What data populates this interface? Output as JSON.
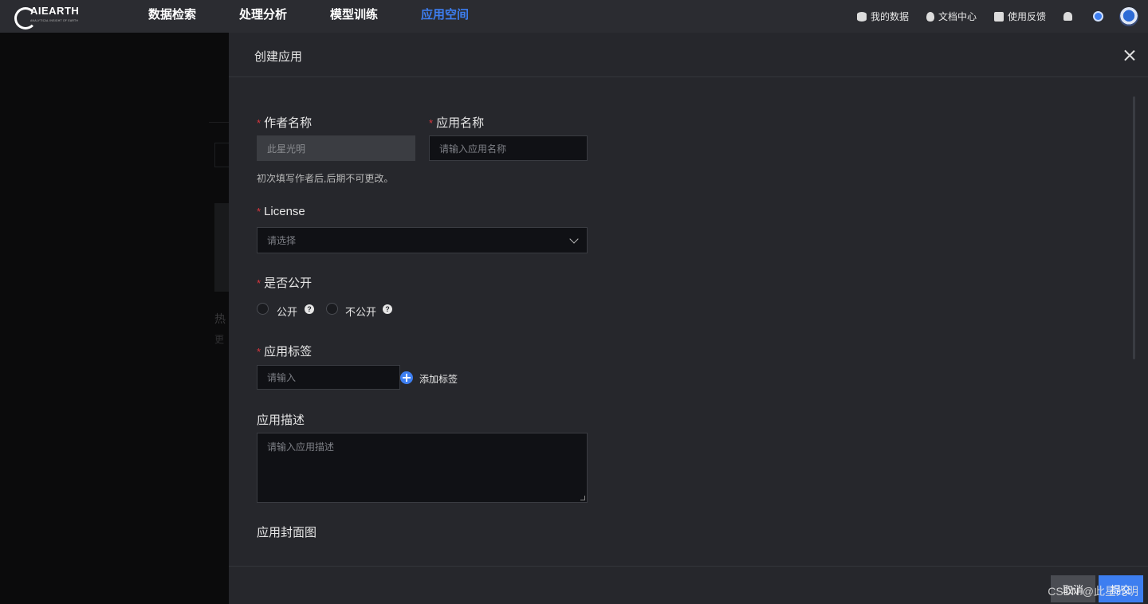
{
  "nav": {
    "logo_text": "AIEARTH",
    "logo_sub": "ANALYTICAL INSIGHT OF EARTH",
    "items": [
      {
        "label": "数据检索"
      },
      {
        "label": "处理分析"
      },
      {
        "label": "模型训练"
      },
      {
        "label": "应用空间"
      }
    ],
    "active": "应用空间",
    "tools": {
      "my_data": "我的数据",
      "docs": "文档中心",
      "feedback": "使用反馈"
    }
  },
  "background": {
    "text1": "热",
    "text2": "更"
  },
  "drawer": {
    "title": "创建应用",
    "author_label": "作者名称",
    "author_value": "此星光明",
    "author_hint": "初次填写作者后,后期不可更改。",
    "app_name_label": "应用名称",
    "app_name_placeholder": "请输入应用名称",
    "license_label": "License",
    "license_placeholder": "请选择",
    "public_label": "是否公开",
    "public_option": "公开",
    "private_option": "不公开",
    "tag_label": "应用标签",
    "tag_placeholder": "请输入",
    "add_tag": "添加标签",
    "desc_label": "应用描述",
    "desc_placeholder": "请输入应用描述",
    "cover_label": "应用封面图",
    "cancel": "取消",
    "submit": "提交",
    "required_mark": "*"
  },
  "watermark": "CSDN @此星光明",
  "colors": {
    "accent": "#3d7ef0",
    "required": "#d9363e",
    "drawer_bg": "#26272c"
  }
}
